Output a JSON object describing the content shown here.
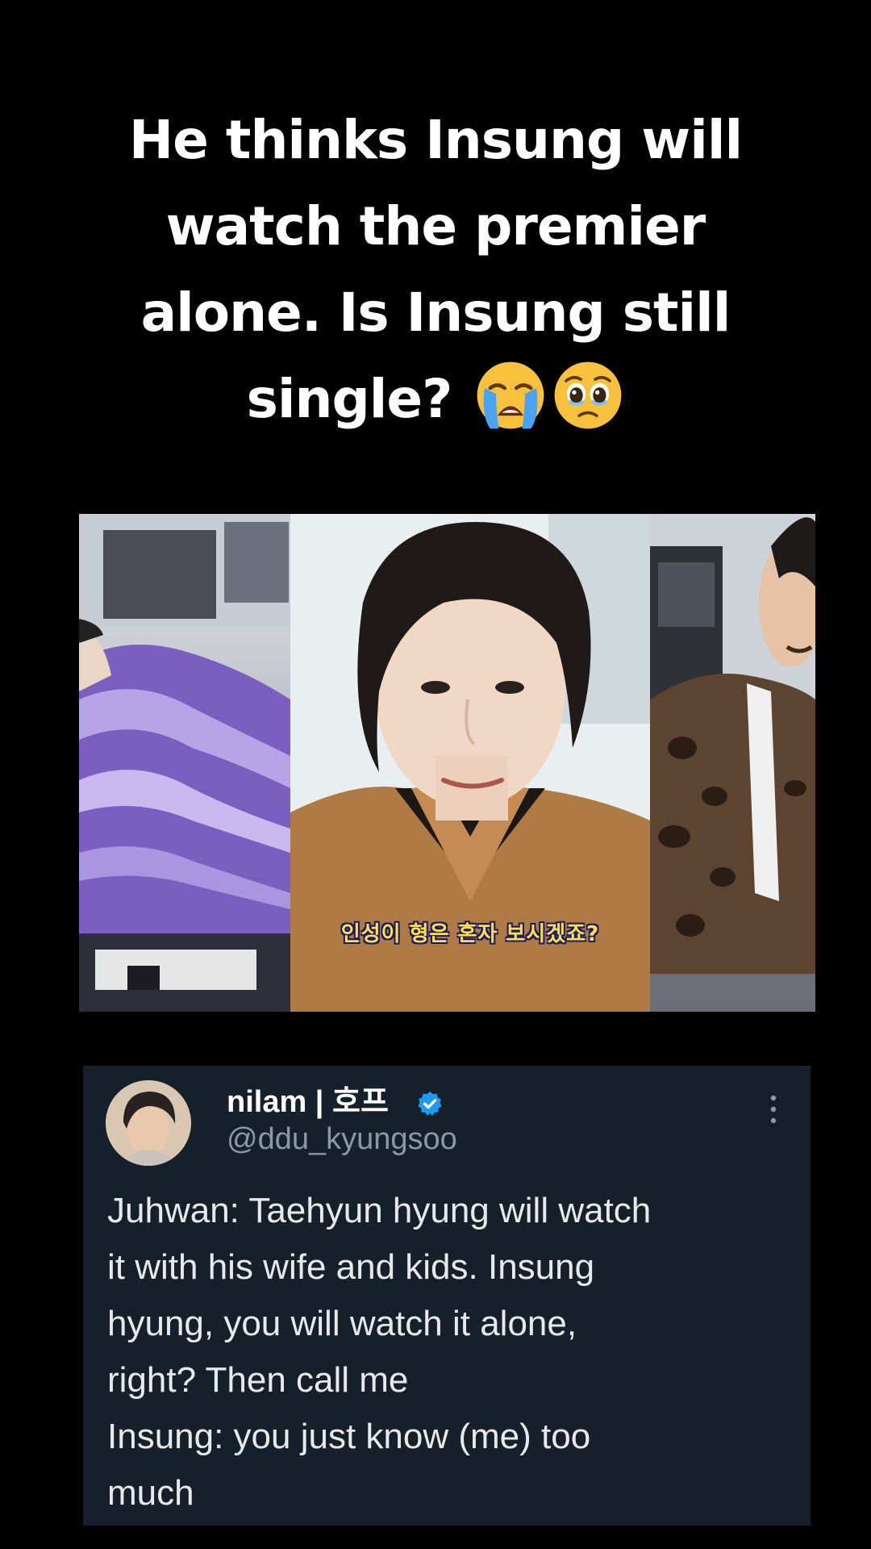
{
  "caption": {
    "lines": [
      "He thinks Insung will",
      "watch the premier",
      "alone. Is Insung still",
      "single?"
    ],
    "emojis": [
      "loudly-crying-face",
      "face-holding-back-tears"
    ]
  },
  "video": {
    "subtitle": "인성이 형은 혼자 보시겠죠?"
  },
  "tweet": {
    "display_name": "nilam | 호프",
    "handle": "@ddu_kyungsoo",
    "verified_icon": "verified-badge-icon",
    "menu_icon": "more-options-icon",
    "body_lines": [
      "Juhwan: Taehyun hyung will watch",
      "it with his wife and kids. Insung",
      "hyung, you will watch it alone,",
      "right? Then call me",
      "Insung: you just know (me) too",
      "much"
    ]
  },
  "colors": {
    "background": "#000000",
    "tweet_background": "#15202b",
    "tweet_text": "#e7e9ea",
    "handle_text": "#8b98a5",
    "verified_blue": "#1d9bf0",
    "subtitle_yellow": "#ffe04a"
  }
}
